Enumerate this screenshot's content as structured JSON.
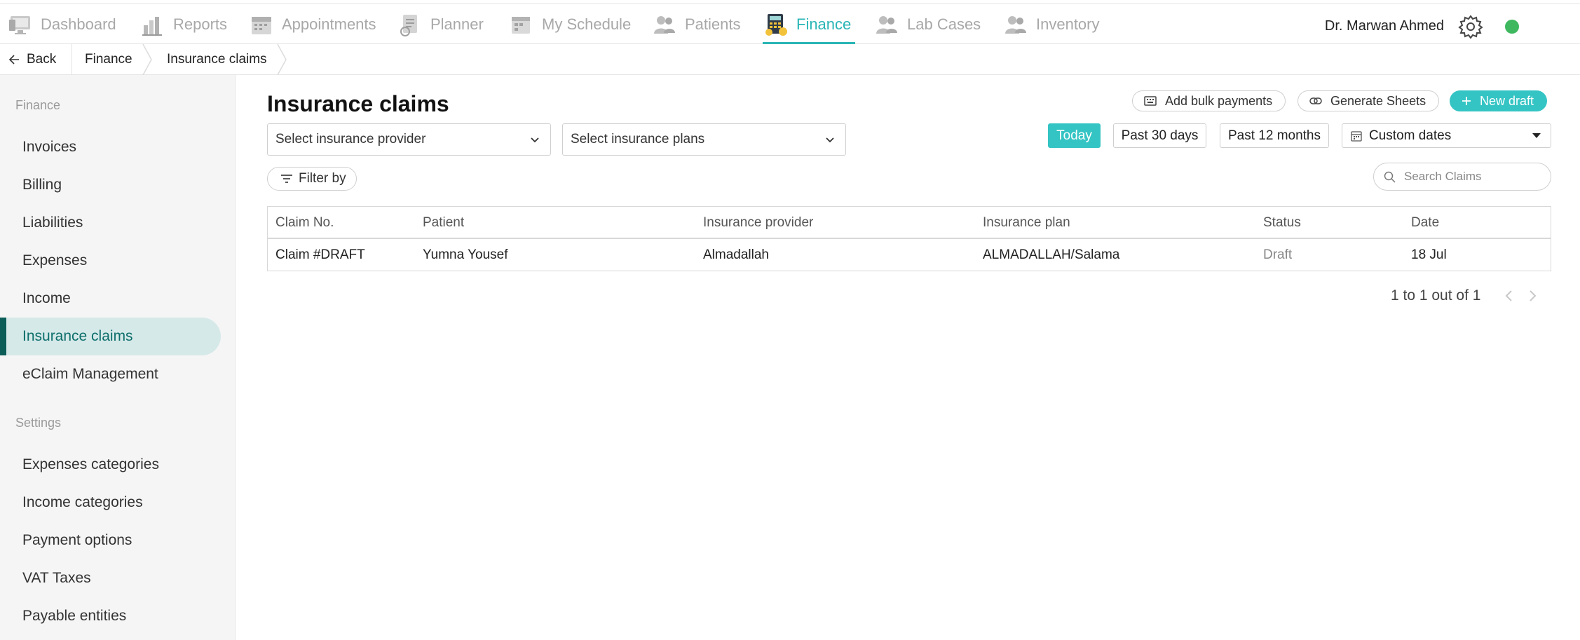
{
  "nav": {
    "items": [
      {
        "label": "Dashboard",
        "icon": "dashboard-icon"
      },
      {
        "label": "Reports",
        "icon": "reports-icon"
      },
      {
        "label": "Appointments",
        "icon": "appointments-icon"
      },
      {
        "label": "Planner",
        "icon": "planner-icon"
      },
      {
        "label": "My Schedule",
        "icon": "schedule-icon"
      },
      {
        "label": "Patients",
        "icon": "patients-icon"
      },
      {
        "label": "Finance",
        "icon": "finance-icon"
      },
      {
        "label": "Lab Cases",
        "icon": "lab-cases-icon"
      },
      {
        "label": "Inventory",
        "icon": "inventory-icon"
      }
    ],
    "active": "Finance",
    "user_name": "Dr. Marwan Ahmed",
    "accent_color": "#2ab5b5",
    "status_color": "#3fb85f"
  },
  "breadcrumb": {
    "back_label": "Back",
    "items": [
      "Finance",
      "Insurance claims"
    ]
  },
  "sidebar": {
    "section_finance": "Finance",
    "finance_items": [
      "Invoices",
      "Billing",
      "Liabilities",
      "Expenses",
      "Income",
      "Insurance claims",
      "eClaim Management"
    ],
    "active_item": "Insurance claims",
    "section_settings": "Settings",
    "settings_items": [
      "Expenses categories",
      "Income categories",
      "Payment options",
      "VAT Taxes",
      "Payable entities"
    ]
  },
  "main": {
    "title": "Insurance claims",
    "actions": {
      "bulk_payments": "Add bulk payments",
      "generate_sheets": "Generate Sheets",
      "new_draft": "New draft"
    },
    "filters": {
      "provider_placeholder": "Select insurance provider",
      "plans_placeholder": "Select insurance plans",
      "filter_by": "Filter by",
      "ranges": [
        "Today",
        "Past 30 days",
        "Past 12 months"
      ],
      "active_range": "Today",
      "custom_dates": "Custom dates",
      "search_placeholder": "Search Claims"
    },
    "table": {
      "columns": [
        "Claim No.",
        "Patient",
        "Insurance provider",
        "Insurance plan",
        "Status",
        "Date"
      ],
      "rows": [
        {
          "claim_no": "Claim #DRAFT",
          "patient": "Yumna Yousef",
          "provider": "Almadallah",
          "plan": "ALMADALLAH/Salama",
          "status": "Draft",
          "date": "18 Jul"
        }
      ]
    },
    "pagination": "1 to 1 out of 1"
  }
}
